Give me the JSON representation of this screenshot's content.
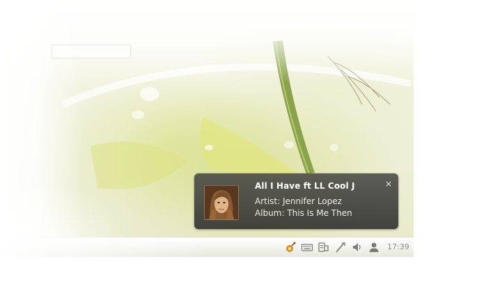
{
  "notification": {
    "title": "All I Have ft LL Cool J",
    "artist": "Artist: Jennifer Lopez",
    "album": "Album: This Is Me Then",
    "close_glyph": "×",
    "cover_icon": "album-cover-image"
  },
  "panel": {
    "clock": "17:39",
    "indicators": [
      {
        "name": "music-player-indicator-icon",
        "color": "#e48a20"
      },
      {
        "name": "keyboard-indicator-icon"
      },
      {
        "name": "messaging-indicator-icon"
      },
      {
        "name": "network-indicator-icon"
      },
      {
        "name": "volume-indicator-icon"
      },
      {
        "name": "user-indicator-icon"
      }
    ]
  }
}
